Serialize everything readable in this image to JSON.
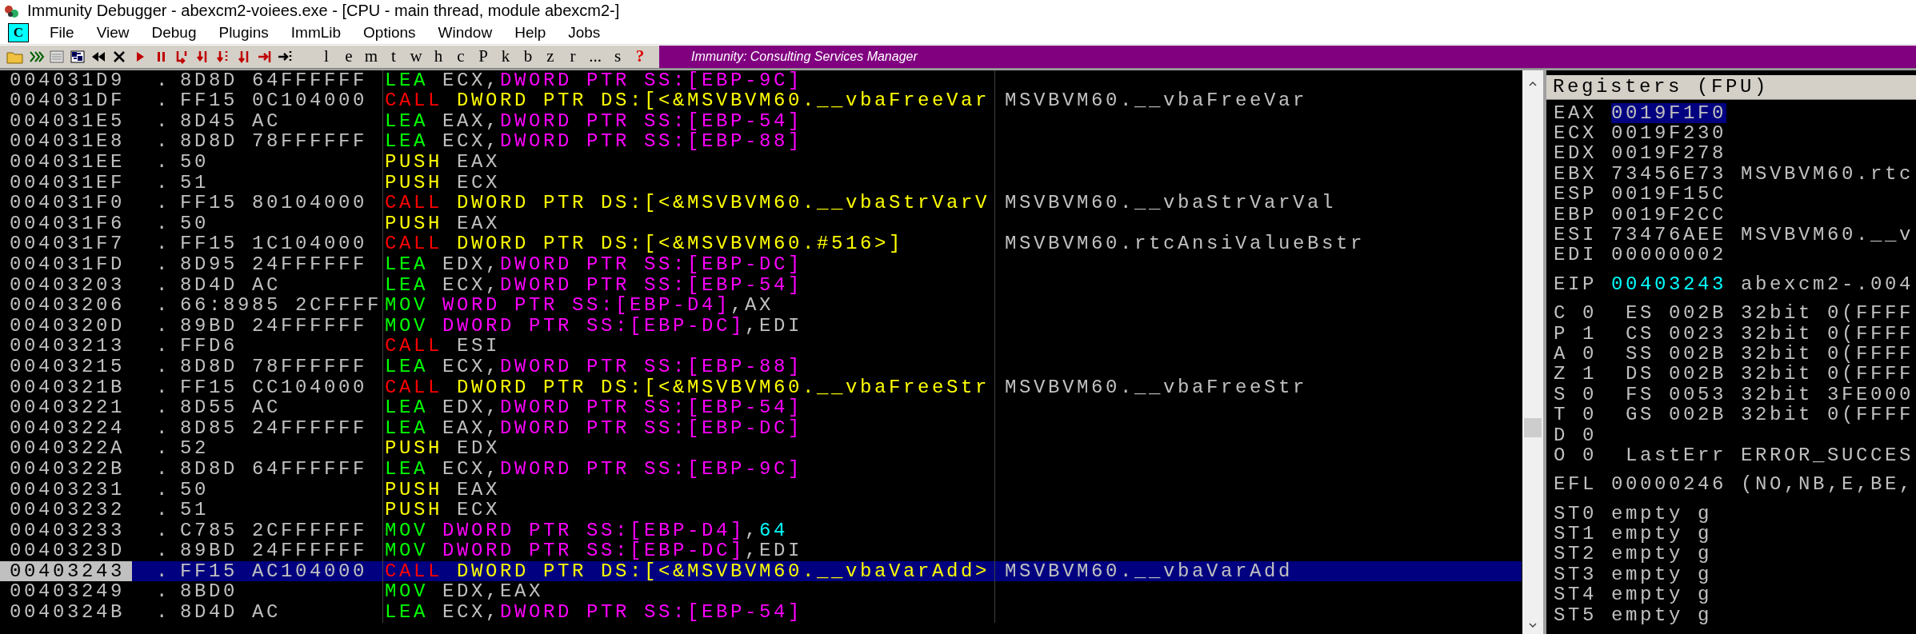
{
  "window": {
    "title": "Immunity Debugger - abexcm2-voiees.exe - [CPU - main thread, module abexcm2-]"
  },
  "menu": {
    "app_icon_letter": "C",
    "items": [
      "File",
      "View",
      "Debug",
      "Plugins",
      "ImmLib",
      "Options",
      "Window",
      "Help",
      "Jobs"
    ]
  },
  "toolbar": {
    "letter_buttons": [
      {
        "label": "l",
        "kind": "letter"
      },
      {
        "label": "e",
        "kind": "letter"
      },
      {
        "label": "m",
        "kind": "letter"
      },
      {
        "label": "t",
        "kind": "letter"
      },
      {
        "label": "w",
        "kind": "letter"
      },
      {
        "label": "h",
        "kind": "letter"
      },
      {
        "label": "c",
        "kind": "letter"
      },
      {
        "label": "P",
        "kind": "letter"
      },
      {
        "label": "k",
        "kind": "letter"
      },
      {
        "label": "b",
        "kind": "letter"
      },
      {
        "label": "z",
        "kind": "letter"
      },
      {
        "label": "r",
        "kind": "letter"
      },
      {
        "label": "...",
        "kind": "letter"
      },
      {
        "label": "s",
        "kind": "letter"
      },
      {
        "label": "?",
        "kind": "help"
      }
    ],
    "banner": "Immunity: Consulting Services Manager"
  },
  "disassembly": {
    "rows": [
      {
        "address": "004031D9",
        "marker": ".",
        "hex": "8D8D 64FFFFFF",
        "mnemonic": "LEA",
        "kind": "lea",
        "operands": [
          {
            "text": "ECX,",
            "kind": "reg"
          },
          {
            "text": "DWORD PTR SS:[EBP-9C]",
            "kind": "mem"
          }
        ],
        "selected": false
      },
      {
        "address": "004031DF",
        "marker": ".",
        "hex": "FF15 0C104000",
        "mnemonic": "CALL",
        "kind": "call",
        "operands": [
          {
            "text": "DWORD PTR DS:[<&MSVBVM60.__vbaFreeVar",
            "kind": "target"
          }
        ],
        "comment": "MSVBVM60.__vbaFreeVar",
        "selected": false
      },
      {
        "address": "004031E5",
        "marker": ".",
        "hex": "8D45 AC",
        "mnemonic": "LEA",
        "kind": "lea",
        "operands": [
          {
            "text": "EAX,",
            "kind": "reg"
          },
          {
            "text": "DWORD PTR SS:[EBP-54]",
            "kind": "mem"
          }
        ],
        "selected": false
      },
      {
        "address": "004031E8",
        "marker": ".",
        "hex": "8D8D 78FFFFFF",
        "mnemonic": "LEA",
        "kind": "lea",
        "operands": [
          {
            "text": "ECX,",
            "kind": "reg"
          },
          {
            "text": "DWORD PTR SS:[EBP-88]",
            "kind": "mem"
          }
        ],
        "selected": false
      },
      {
        "address": "004031EE",
        "marker": ".",
        "hex": "50",
        "mnemonic": "PUSH",
        "kind": "push",
        "operands": [
          {
            "text": "EAX",
            "kind": "reg"
          }
        ],
        "selected": false
      },
      {
        "address": "004031EF",
        "marker": ".",
        "hex": "51",
        "mnemonic": "PUSH",
        "kind": "push",
        "operands": [
          {
            "text": "ECX",
            "kind": "reg"
          }
        ],
        "selected": false
      },
      {
        "address": "004031F0",
        "marker": ".",
        "hex": "FF15 80104000",
        "mnemonic": "CALL",
        "kind": "call",
        "operands": [
          {
            "text": "DWORD PTR DS:[<&MSVBVM60.__vbaStrVarV",
            "kind": "target"
          }
        ],
        "comment": "MSVBVM60.__vbaStrVarVal",
        "selected": false
      },
      {
        "address": "004031F6",
        "marker": ".",
        "hex": "50",
        "mnemonic": "PUSH",
        "kind": "push",
        "operands": [
          {
            "text": "EAX",
            "kind": "reg"
          }
        ],
        "selected": false
      },
      {
        "address": "004031F7",
        "marker": ".",
        "hex": "FF15 1C104000",
        "mnemonic": "CALL",
        "kind": "call",
        "operands": [
          {
            "text": "DWORD PTR DS:[<&MSVBVM60.#516>]",
            "kind": "target"
          }
        ],
        "comment": "MSVBVM60.rtcAnsiValueBstr",
        "selected": false
      },
      {
        "address": "004031FD",
        "marker": ".",
        "hex": "8D95 24FFFFFF",
        "mnemonic": "LEA",
        "kind": "lea",
        "operands": [
          {
            "text": "EDX,",
            "kind": "reg"
          },
          {
            "text": "DWORD PTR SS:[EBP-DC]",
            "kind": "mem"
          }
        ],
        "selected": false
      },
      {
        "address": "00403203",
        "marker": ".",
        "hex": "8D4D AC",
        "mnemonic": "LEA",
        "kind": "lea",
        "operands": [
          {
            "text": "ECX,",
            "kind": "reg"
          },
          {
            "text": "DWORD PTR SS:[EBP-54]",
            "kind": "mem"
          }
        ],
        "selected": false
      },
      {
        "address": "00403206",
        "marker": ".",
        "hex": "66:8985 2CFFFF",
        "mnemonic": "MOV",
        "kind": "mov",
        "operands": [
          {
            "text": "WORD PTR SS:[EBP-D4]",
            "kind": "mem"
          },
          {
            "text": ",AX",
            "kind": "reg"
          }
        ],
        "selected": false
      },
      {
        "address": "0040320D",
        "marker": ".",
        "hex": "89BD 24FFFFFF",
        "mnemonic": "MOV",
        "kind": "mov",
        "operands": [
          {
            "text": "DWORD PTR SS:[EBP-DC]",
            "kind": "mem"
          },
          {
            "text": ",EDI",
            "kind": "reg"
          }
        ],
        "selected": false
      },
      {
        "address": "00403213",
        "marker": ".",
        "hex": "FFD6",
        "mnemonic": "CALL",
        "kind": "call",
        "operands": [
          {
            "text": "ESI",
            "kind": "reg"
          }
        ],
        "selected": false
      },
      {
        "address": "00403215",
        "marker": ".",
        "hex": "8D8D 78FFFFFF",
        "mnemonic": "LEA",
        "kind": "lea",
        "operands": [
          {
            "text": "ECX,",
            "kind": "reg"
          },
          {
            "text": "DWORD PTR SS:[EBP-88]",
            "kind": "mem"
          }
        ],
        "selected": false
      },
      {
        "address": "0040321B",
        "marker": ".",
        "hex": "FF15 CC104000",
        "mnemonic": "CALL",
        "kind": "call",
        "operands": [
          {
            "text": "DWORD PTR DS:[<&MSVBVM60.__vbaFreeStr",
            "kind": "target"
          }
        ],
        "comment": "MSVBVM60.__vbaFreeStr",
        "selected": false
      },
      {
        "address": "00403221",
        "marker": ".",
        "hex": "8D55 AC",
        "mnemonic": "LEA",
        "kind": "lea",
        "operands": [
          {
            "text": "EDX,",
            "kind": "reg"
          },
          {
            "text": "DWORD PTR SS:[EBP-54]",
            "kind": "mem"
          }
        ],
        "selected": false
      },
      {
        "address": "00403224",
        "marker": ".",
        "hex": "8D85 24FFFFFF",
        "mnemonic": "LEA",
        "kind": "lea",
        "operands": [
          {
            "text": "EAX,",
            "kind": "reg"
          },
          {
            "text": "DWORD PTR SS:[EBP-DC]",
            "kind": "mem"
          }
        ],
        "selected": false
      },
      {
        "address": "0040322A",
        "marker": ".",
        "hex": "52",
        "mnemonic": "PUSH",
        "kind": "push",
        "operands": [
          {
            "text": "EDX",
            "kind": "reg"
          }
        ],
        "selected": false
      },
      {
        "address": "0040322B",
        "marker": ".",
        "hex": "8D8D 64FFFFFF",
        "mnemonic": "LEA",
        "kind": "lea",
        "operands": [
          {
            "text": "ECX,",
            "kind": "reg"
          },
          {
            "text": "DWORD PTR SS:[EBP-9C]",
            "kind": "mem"
          }
        ],
        "selected": false
      },
      {
        "address": "00403231",
        "marker": ".",
        "hex": "50",
        "mnemonic": "PUSH",
        "kind": "push",
        "operands": [
          {
            "text": "EAX",
            "kind": "reg"
          }
        ],
        "selected": false
      },
      {
        "address": "00403232",
        "marker": ".",
        "hex": "51",
        "mnemonic": "PUSH",
        "kind": "push",
        "operands": [
          {
            "text": "ECX",
            "kind": "reg"
          }
        ],
        "selected": false
      },
      {
        "address": "00403233",
        "marker": ".",
        "hex": "C785 2CFFFFFF",
        "mnemonic": "MOV",
        "kind": "mov",
        "operands": [
          {
            "text": "DWORD PTR SS:[EBP-D4]",
            "kind": "mem"
          },
          {
            "text": ",",
            "kind": "reg"
          },
          {
            "text": "64",
            "kind": "const"
          }
        ],
        "selected": false
      },
      {
        "address": "0040323D",
        "marker": ".",
        "hex": "89BD 24FFFFFF",
        "mnemonic": "MOV",
        "kind": "mov",
        "operands": [
          {
            "text": "DWORD PTR SS:[EBP-DC]",
            "kind": "mem"
          },
          {
            "text": ",EDI",
            "kind": "reg"
          }
        ],
        "selected": false
      },
      {
        "address": "00403243",
        "marker": ".",
        "hex": "FF15 AC104000",
        "mnemonic": "CALL",
        "kind": "call",
        "operands": [
          {
            "text": "DWORD PTR DS:[<&MSVBVM60.__vbaVarAdd>",
            "kind": "target"
          }
        ],
        "comment": "MSVBVM60.__vbaVarAdd",
        "selected": true
      },
      {
        "address": "00403249",
        "marker": ".",
        "hex": "8BD0",
        "mnemonic": "MOV",
        "kind": "plain",
        "operands": [
          {
            "text": "EDX,EAX",
            "kind": "reg"
          }
        ],
        "selected": false
      },
      {
        "address": "0040324B",
        "marker": ".",
        "hex": "8D4D AC",
        "mnemonic": "LEA",
        "kind": "lea",
        "operands": [
          {
            "text": "ECX,",
            "kind": "reg"
          },
          {
            "text": "DWORD PTR SS:[EBP-54]",
            "kind": "mem"
          }
        ],
        "selected": false
      }
    ]
  },
  "registers": {
    "title": "Registers (FPU)",
    "groups": [
      {
        "kind": "general",
        "rows": [
          {
            "name": "EAX",
            "value": "0019F1F0",
            "selected": true,
            "highlighted": false
          },
          {
            "name": "ECX",
            "value": "0019F230",
            "selected": false,
            "highlighted": false
          },
          {
            "name": "EDX",
            "value": "0019F278",
            "selected": false,
            "highlighted": false
          },
          {
            "name": "EBX",
            "value": "73456E73",
            "info": "MSVBVM60.rtc",
            "selected": false,
            "highlighted": false
          },
          {
            "name": "ESP",
            "value": "0019F15C",
            "selected": false,
            "highlighted": false
          },
          {
            "name": "EBP",
            "value": "0019F2CC",
            "selected": false,
            "highlighted": false
          },
          {
            "name": "ESI",
            "value": "73476AEE",
            "info": "MSVBVM60.__v",
            "selected": false,
            "highlighted": false
          },
          {
            "name": "EDI",
            "value": "00000002",
            "selected": false,
            "highlighted": false
          }
        ]
      },
      {
        "kind": "general",
        "rows": [
          {
            "name": "EIP",
            "value": "00403243",
            "info": "abexcm2-.004",
            "selected": false,
            "highlighted": true
          }
        ]
      },
      {
        "kind": "flags",
        "rows": [
          {
            "name": "C",
            "value": "0",
            "info": "ES 002B 32bit 0(FFFF",
            "selected": false,
            "highlighted": false
          },
          {
            "name": "P",
            "value": "1",
            "info": "CS 0023 32bit 0(FFFF",
            "selected": false,
            "highlighted": false
          },
          {
            "name": "A",
            "value": "0",
            "info": "SS 002B 32bit 0(FFFF",
            "selected": false,
            "highlighted": false
          },
          {
            "name": "Z",
            "value": "1",
            "info": "DS 002B 32bit 0(FFFF",
            "selected": false,
            "highlighted": false
          },
          {
            "name": "S",
            "value": "0",
            "info": "FS 0053 32bit 3FE000",
            "selected": false,
            "highlighted": false
          },
          {
            "name": "T",
            "value": "0",
            "info": "GS 002B 32bit 0(FFFF",
            "selected": false,
            "highlighted": false
          },
          {
            "name": "D",
            "value": "0",
            "selected": false,
            "highlighted": false
          },
          {
            "name": "O",
            "value": "0",
            "info": "LastErr ERROR_SUCCES",
            "selected": false,
            "highlighted": false
          }
        ]
      },
      {
        "kind": "general",
        "rows": [
          {
            "name": "EFL",
            "value": "00000246",
            "info": "(NO,NB,E,BE,",
            "selected": false,
            "highlighted": false
          }
        ]
      },
      {
        "kind": "general",
        "rows": [
          {
            "name": "ST0",
            "value": "empty g",
            "selected": false,
            "highlighted": false
          },
          {
            "name": "ST1",
            "value": "empty g",
            "selected": false,
            "highlighted": false
          },
          {
            "name": "ST2",
            "value": "empty g",
            "selected": false,
            "highlighted": false
          },
          {
            "name": "ST3",
            "value": "empty g",
            "selected": false,
            "highlighted": false
          },
          {
            "name": "ST4",
            "value": "empty g",
            "selected": false,
            "highlighted": false
          },
          {
            "name": "ST5",
            "value": "empty g",
            "selected": false,
            "highlighted": false
          }
        ]
      }
    ]
  }
}
